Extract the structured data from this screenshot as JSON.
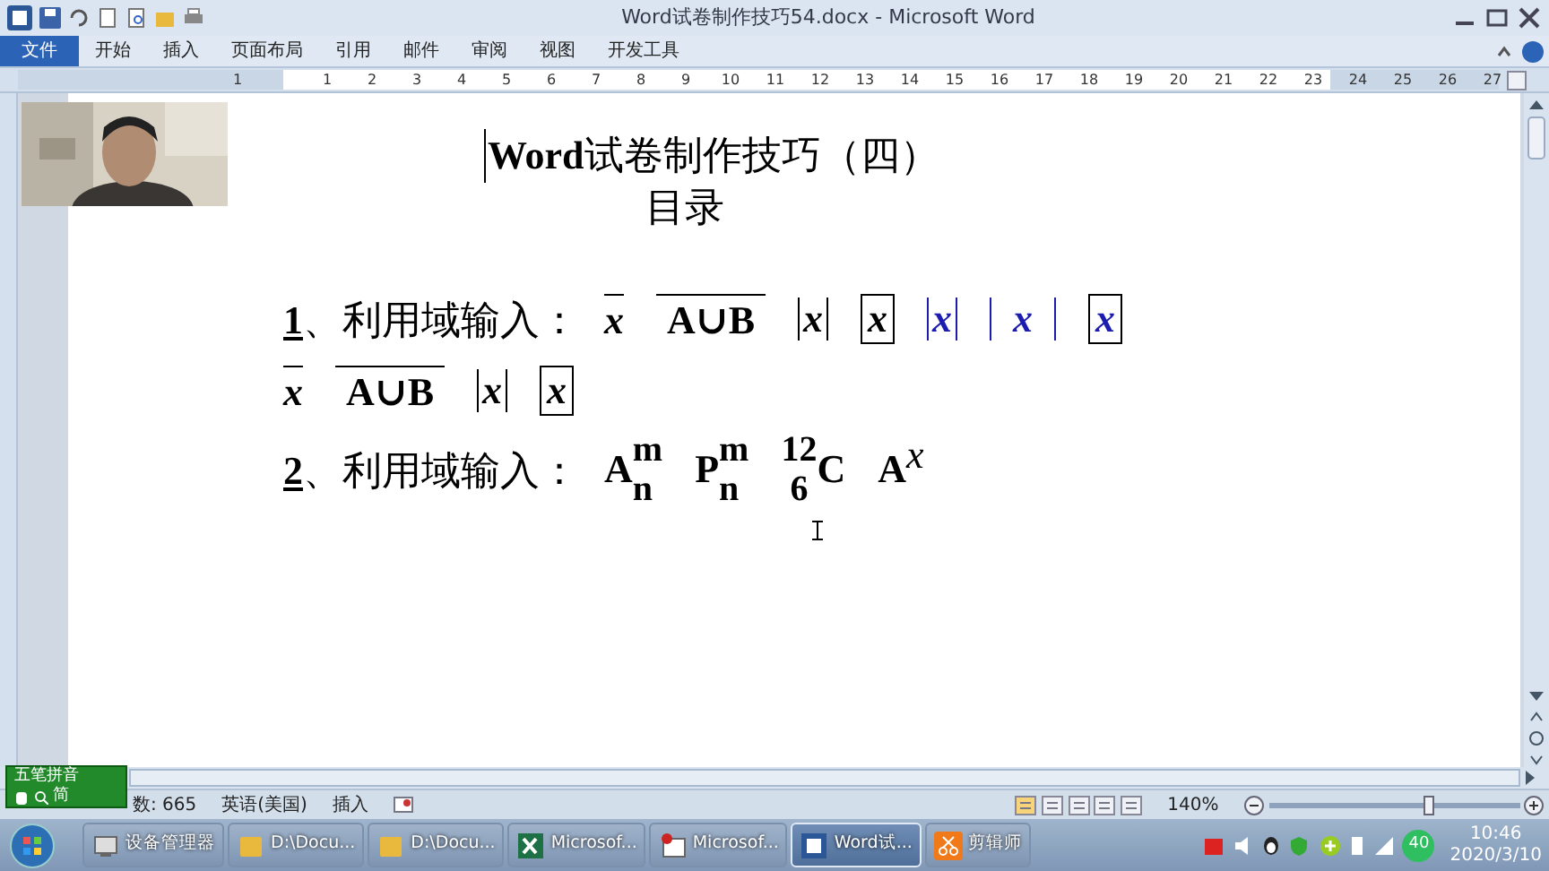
{
  "window": {
    "title": "Word试卷制作技巧54.docx - Microsoft Word"
  },
  "tabs": [
    {
      "label": "文件",
      "selected": true
    },
    {
      "label": "开始",
      "selected": false
    },
    {
      "label": "插入",
      "selected": false
    },
    {
      "label": "页面布局",
      "selected": false
    },
    {
      "label": "引用",
      "selected": false
    },
    {
      "label": "邮件",
      "selected": false
    },
    {
      "label": "审阅",
      "selected": false
    },
    {
      "label": "视图",
      "selected": false
    },
    {
      "label": "开发工具",
      "selected": false
    }
  ],
  "ruler": {
    "left_numbers": [
      "1"
    ],
    "numbers": [
      "1",
      "2",
      "3",
      "4",
      "5",
      "6",
      "7",
      "8",
      "9",
      "10",
      "11",
      "12",
      "13",
      "14",
      "15",
      "16",
      "17",
      "18",
      "19",
      "20",
      "21",
      "22",
      "23",
      "24",
      "25",
      "26",
      "27"
    ]
  },
  "document": {
    "title": "**Word**试卷制作技巧（四）",
    "subtitle": "目录",
    "lines": [
      {
        "number": "1",
        "label": "、利用域输入：",
        "items": [
          {
            "kind": "overline",
            "text": "x",
            "italic": true,
            "color": "#000000"
          },
          {
            "kind": "overline",
            "text": "A∪B",
            "italic": false,
            "color": "#000000"
          },
          {
            "kind": "abs",
            "text": "x",
            "italic": true,
            "color": "#000000"
          },
          {
            "kind": "box",
            "text": "x",
            "italic": true,
            "color": "#000000"
          },
          {
            "kind": "abs",
            "text": "x",
            "italic": true,
            "color": "#1c1cb0"
          },
          {
            "kind": "abs_wide",
            "text": "x",
            "italic": true,
            "color": "#1c1cb0"
          },
          {
            "kind": "box",
            "text": "x",
            "italic": true,
            "color": "#1c1cb0"
          }
        ]
      },
      {
        "items": [
          {
            "kind": "overline",
            "text": "x",
            "italic": true,
            "color": "#000000"
          },
          {
            "kind": "overline",
            "text": "A∪B",
            "italic": false,
            "color": "#000000"
          },
          {
            "kind": "abs",
            "text": "x",
            "italic": true,
            "color": "#000000"
          },
          {
            "kind": "box",
            "text": "x",
            "italic": true,
            "color": "#000000"
          }
        ]
      },
      {
        "number": "2",
        "label": "、利用域输入：",
        "items": [
          {
            "kind": "subsup",
            "base": "A",
            "sup": "m",
            "sub": "n"
          },
          {
            "kind": "subsup",
            "base": "P",
            "sup": "m",
            "sub": "n"
          },
          {
            "kind": "presubsup",
            "base": "C",
            "sup": "12",
            "sub": "6"
          },
          {
            "kind": "sup",
            "base": "A",
            "sup": "x"
          }
        ]
      }
    ]
  },
  "ime": {
    "label": "五笔拼音",
    "mode": "简"
  },
  "status_bar": {
    "words": "数: 665",
    "language": "英语(美国)",
    "mode": "插入",
    "zoom": "140%",
    "zoom_slider": {
      "level": 0.62
    }
  },
  "taskbar": {
    "buttons": [
      {
        "label": "设备管理器",
        "kind": "device",
        "selected": false
      },
      {
        "label": "D:\\Docu...",
        "kind": "folder",
        "selected": false
      },
      {
        "label": "D:\\Docu...",
        "kind": "folder",
        "selected": false
      },
      {
        "label": "Microsof...",
        "kind": "excel",
        "selected": false
      },
      {
        "label": "Microsof...",
        "kind": "app",
        "selected": false
      },
      {
        "label": "Word试...",
        "kind": "word",
        "selected": true
      },
      {
        "label": "剪辑师",
        "kind": "scissors",
        "selected": false
      }
    ],
    "badge": "40",
    "time": "10:46",
    "date": "2020/3/10"
  }
}
